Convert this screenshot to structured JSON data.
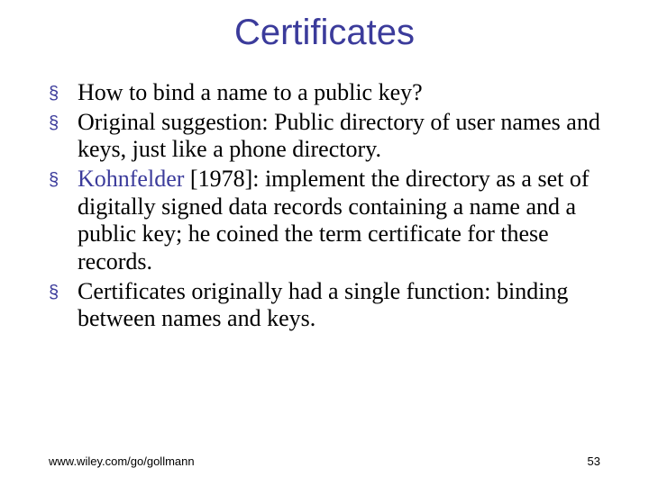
{
  "title": "Certificates",
  "bullets": [
    "How to bind a name to a public key?",
    "Original suggestion: Public directory of user names and keys, just like a phone directory.",
    "Kohnfelder [1978]: implement the directory as a set of digitally signed data records containing a name and a public key; he coined the term certificate for these records.",
    "Certificates originally had a single function: binding between names and keys."
  ],
  "bullet2_parts": {
    "highlight": "Kohnfelder",
    "rest": " [1978]: implement the directory as a set of digitally signed data records containing a name and a public key; he coined the term certificate for these records."
  },
  "footer": {
    "url": "www.wiley.com/go/gollmann",
    "page": "53"
  },
  "bullet_glyph": "§"
}
